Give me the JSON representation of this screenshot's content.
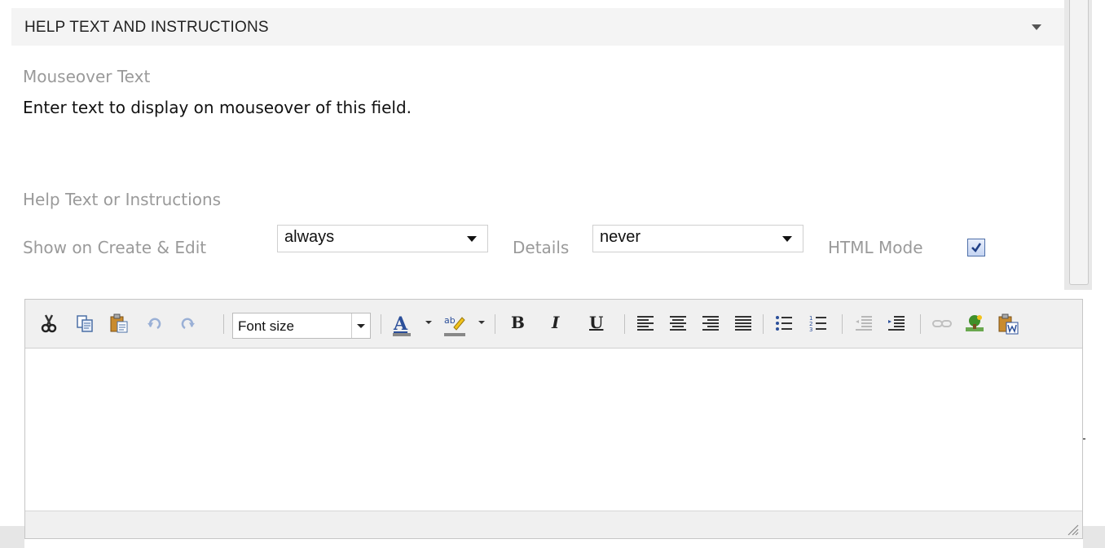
{
  "section": {
    "title": "HELP TEXT AND INSTRUCTIONS"
  },
  "mouseover": {
    "label": "Mouseover Text",
    "value": "Enter text to display on mouseover of this field."
  },
  "help": {
    "label": "Help Text or Instructions",
    "show_label": "Show on Create & Edit",
    "show_value": "always",
    "details_label": "Details",
    "details_value": "never",
    "html_mode_label": "HTML Mode",
    "html_mode_checked": true
  },
  "editor": {
    "font_size_label": "Font size",
    "bold": "B",
    "italic": "I",
    "underline": "U",
    "toolbar_icons": [
      "cut-icon",
      "copy-icon",
      "paste-icon",
      "undo-icon",
      "redo-icon",
      "font-color-icon",
      "highlight-icon",
      "bold-icon",
      "italic-icon",
      "underline-icon",
      "align-left-icon",
      "align-center-icon",
      "align-right-icon",
      "justify-icon",
      "bullet-list-icon",
      "numbered-list-icon",
      "outdent-icon",
      "indent-icon",
      "link-icon",
      "image-icon",
      "paste-word-icon"
    ],
    "colors": {
      "font_color_bar": "#888888",
      "highlight_bar": "#888888",
      "accent": "#4d6ea8"
    }
  }
}
